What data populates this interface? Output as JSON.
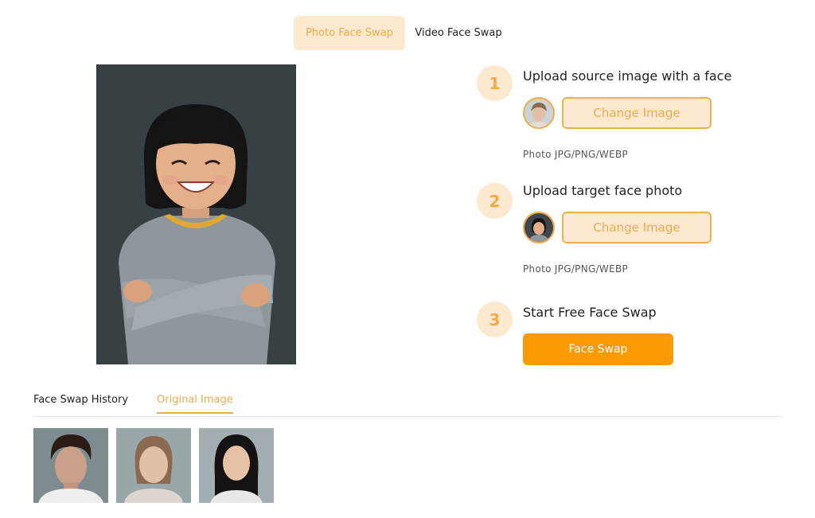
{
  "mode_tabs": {
    "photo": "Photo Face Swap",
    "video": "Video Face Swap"
  },
  "steps": [
    {
      "number": "1",
      "title": "Upload source image with a face",
      "button": "Change Image",
      "hint": "Photo JPG/PNG/WEBP"
    },
    {
      "number": "2",
      "title": "Upload target face photo",
      "button": "Change Image",
      "hint": "Photo JPG/PNG/WEBP"
    },
    {
      "number": "3",
      "title": "Start Free Face Swap",
      "button": "Face Swap"
    }
  ],
  "bottom_tabs": {
    "history": "Face Swap History",
    "original": "Original Image"
  },
  "colors": {
    "accent": "#f3a94a",
    "accent_light": "#fde9cf",
    "primary_button": "#fb9b00"
  }
}
